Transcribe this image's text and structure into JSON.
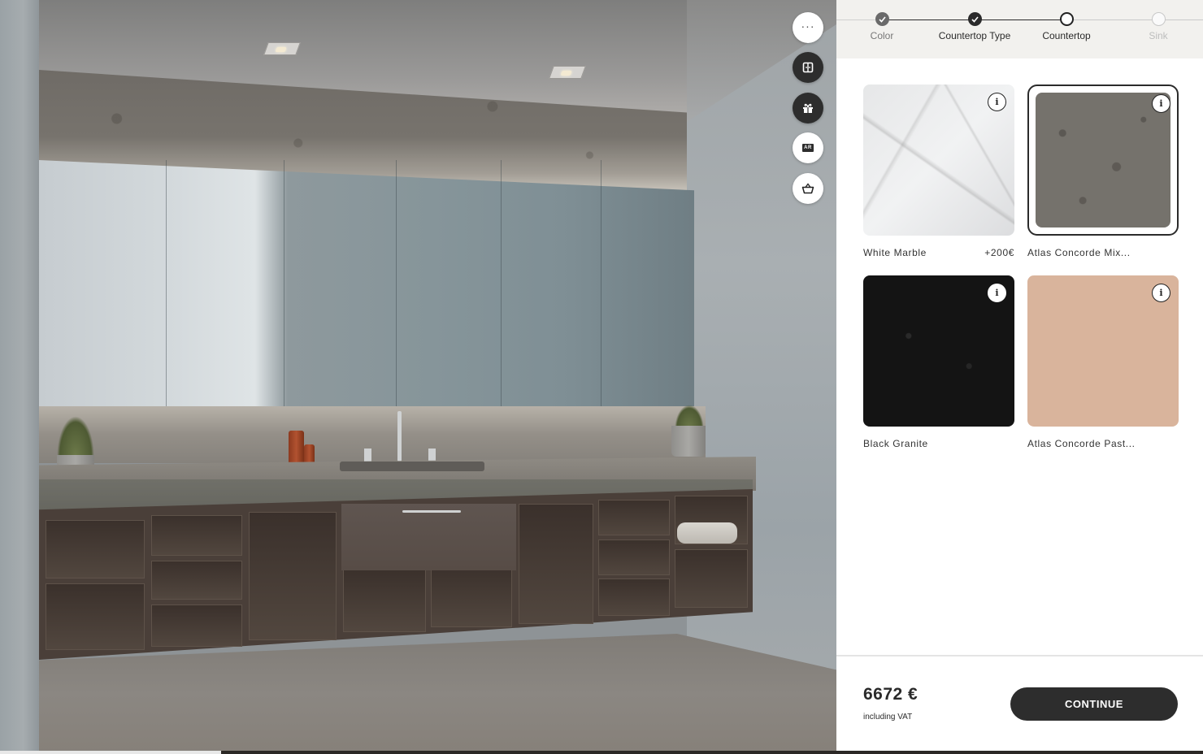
{
  "toolbar": {
    "buttons": [
      {
        "id": "more",
        "icon": "more-options-icon",
        "glyph": "···",
        "variant": "light"
      },
      {
        "id": "layout",
        "icon": "wardrobe-door-icon",
        "variant": "dark"
      },
      {
        "id": "gift",
        "icon": "gift-icon",
        "variant": "dark"
      },
      {
        "id": "ar",
        "icon": "ar-icon",
        "glyph": "AR",
        "variant": "light"
      },
      {
        "id": "cart",
        "icon": "basket-icon",
        "variant": "light"
      }
    ]
  },
  "stepper": {
    "steps": [
      {
        "label": "Color",
        "state": "completed"
      },
      {
        "label": "Countertop Type",
        "state": "completed"
      },
      {
        "label": "Countertop",
        "state": "current"
      },
      {
        "label": "Sink",
        "state": "upcoming"
      }
    ]
  },
  "options": [
    {
      "name": "White Marble",
      "price": "+200€",
      "selected": false,
      "swatch_color": "#e9eaeb"
    },
    {
      "name": "Atlas Concorde Mix...",
      "price": "",
      "selected": true,
      "swatch_color": "#75726c"
    },
    {
      "name": "Black Granite",
      "price": "",
      "selected": false,
      "swatch_color": "#141414"
    },
    {
      "name": "Atlas Concorde Past...",
      "price": "",
      "selected": false,
      "swatch_color": "#d9b49c"
    }
  ],
  "info_glyph": "i",
  "footer": {
    "price": "6672 €",
    "vat_note": "including VAT",
    "continue_label": "CONTINUE"
  },
  "colors": {
    "accent_dark": "#2d2d2d",
    "stepper_bg": "#f2f1ee"
  }
}
